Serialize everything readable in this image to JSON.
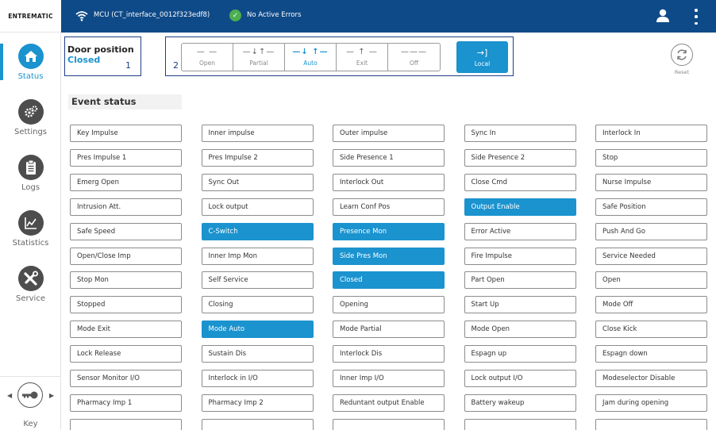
{
  "header": {
    "brand": "ENTREMATIC",
    "connection": "MCU (CT_interface_0012f323edf8)",
    "errors": "No Active Errors"
  },
  "sidebar": {
    "items": [
      {
        "label": "Status",
        "icon": "home-icon",
        "active": true
      },
      {
        "label": "Settings",
        "icon": "gears-icon",
        "active": false
      },
      {
        "label": "Logs",
        "icon": "clipboard-icon",
        "active": false
      },
      {
        "label": "Statistics",
        "icon": "chart-icon",
        "active": false
      },
      {
        "label": "Service",
        "icon": "tools-icon",
        "active": false
      }
    ],
    "key_label": "Key"
  },
  "door": {
    "title": "Door position",
    "value": "Closed",
    "marker": "1"
  },
  "mode": {
    "marker": "2",
    "options": [
      {
        "label": "Open",
        "glyph": "— —",
        "active": false
      },
      {
        "label": "Partial",
        "glyph": "—↓↑—",
        "active": false
      },
      {
        "label": "Auto",
        "glyph": "—↓ ↑—",
        "active": true
      },
      {
        "label": "Exit",
        "glyph": "— ↑ —",
        "active": false
      },
      {
        "label": "Off",
        "glyph": "———",
        "active": false
      }
    ],
    "local": {
      "label": "Local",
      "glyph": "→]"
    }
  },
  "reset_label": "Reset",
  "events": {
    "title": "Event status",
    "rows": [
      [
        {
          "t": "Key Impulse",
          "on": false
        },
        {
          "t": "Inner impulse",
          "on": false
        },
        {
          "t": "Outer impulse",
          "on": false
        },
        {
          "t": "Sync In",
          "on": false
        },
        {
          "t": "Interlock In",
          "on": false
        }
      ],
      [
        {
          "t": "Pres Impulse 1",
          "on": false
        },
        {
          "t": "Pres Impulse 2",
          "on": false
        },
        {
          "t": "Side Presence 1",
          "on": false
        },
        {
          "t": "Side Presence 2",
          "on": false
        },
        {
          "t": "Stop",
          "on": false
        }
      ],
      [
        {
          "t": "Emerg Open",
          "on": false
        },
        {
          "t": "Sync Out",
          "on": false
        },
        {
          "t": "Interlock Out",
          "on": false
        },
        {
          "t": "Close Cmd",
          "on": false
        },
        {
          "t": "Nurse Impulse",
          "on": false
        }
      ],
      [
        {
          "t": "Intrusion Att.",
          "on": false
        },
        {
          "t": "Lock output",
          "on": false
        },
        {
          "t": "Learn Conf Pos",
          "on": false
        },
        {
          "t": "Output Enable",
          "on": true
        },
        {
          "t": "Safe Position",
          "on": false
        }
      ],
      [
        {
          "t": "Safe Speed",
          "on": false
        },
        {
          "t": "C-Switch",
          "on": true
        },
        {
          "t": "Presence Mon",
          "on": true
        },
        {
          "t": "Error Active",
          "on": false
        },
        {
          "t": "Push And Go",
          "on": false
        }
      ],
      [
        {
          "t": "Open/Close Imp",
          "on": false
        },
        {
          "t": "Inner Imp Mon",
          "on": false
        },
        {
          "t": "Side Pres Mon",
          "on": true
        },
        {
          "t": "Fire Impulse",
          "on": false
        },
        {
          "t": "Service Needed",
          "on": false
        }
      ],
      [
        {
          "t": "Stop Mon",
          "on": false
        },
        {
          "t": "Self Service",
          "on": false
        },
        {
          "t": "Closed",
          "on": true
        },
        {
          "t": "Part Open",
          "on": false
        },
        {
          "t": "Open",
          "on": false
        }
      ],
      [
        {
          "t": "Stopped",
          "on": false
        },
        {
          "t": "Closing",
          "on": false
        },
        {
          "t": "Opening",
          "on": false
        },
        {
          "t": "Start Up",
          "on": false
        },
        {
          "t": "Mode Off",
          "on": false
        }
      ],
      [
        {
          "t": "Mode Exit",
          "on": false
        },
        {
          "t": "Mode Auto",
          "on": true
        },
        {
          "t": "Mode Partial",
          "on": false
        },
        {
          "t": "Mode Open",
          "on": false
        },
        {
          "t": "Close Kick",
          "on": false
        }
      ],
      [
        {
          "t": "Lock Release",
          "on": false
        },
        {
          "t": "Sustain Dis",
          "on": false
        },
        {
          "t": "Interlock Dis",
          "on": false
        },
        {
          "t": "Espagn up",
          "on": false
        },
        {
          "t": "Espagn down",
          "on": false
        }
      ],
      [
        {
          "t": "Sensor Monitor I/O",
          "on": false
        },
        {
          "t": "Interlock in I/O",
          "on": false
        },
        {
          "t": "Inner Imp I/O",
          "on": false
        },
        {
          "t": "Lock output I/O",
          "on": false
        },
        {
          "t": "Modeselector Disable",
          "on": false
        }
      ],
      [
        {
          "t": "Pharmacy Imp 1",
          "on": false
        },
        {
          "t": "Pharmacy Imp 2",
          "on": false
        },
        {
          "t": "Reduntant output Enable",
          "on": false
        },
        {
          "t": "Battery wakeup",
          "on": false
        },
        {
          "t": "Jam during opening",
          "on": false
        }
      ],
      [
        {
          "t": "",
          "on": false
        },
        {
          "t": "",
          "on": false
        },
        {
          "t": "",
          "on": false
        },
        {
          "t": "",
          "on": false
        },
        {
          "t": "",
          "on": false
        }
      ]
    ]
  },
  "colors": {
    "topbar": "#0f4a88",
    "accent": "#1a93cf",
    "ok": "#4caf50",
    "highlight_box": "#1d3f88"
  }
}
